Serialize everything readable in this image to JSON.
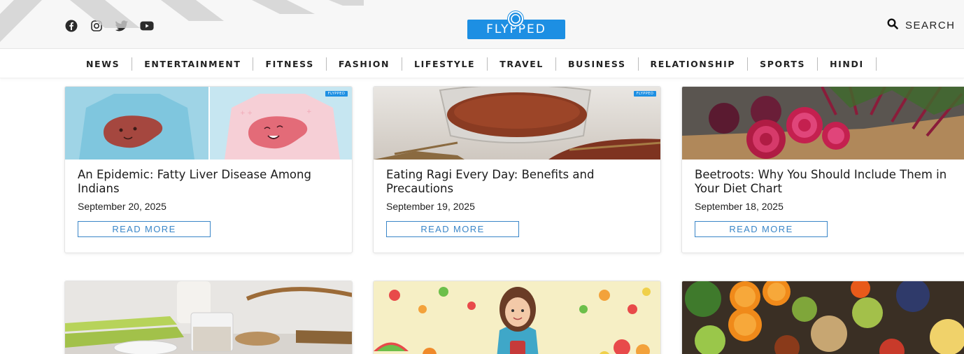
{
  "header": {
    "logo_text": "FLYPPED",
    "search_label": "SEARCH"
  },
  "social_icons": [
    "facebook-icon",
    "instagram-icon",
    "twitter-icon",
    "youtube-icon"
  ],
  "nav": {
    "items": [
      "NEWS",
      "ENTERTAINMENT",
      "FITNESS",
      "FASHION",
      "LIFESTYLE",
      "TRAVEL",
      "BUSINESS",
      "RELATIONSHIP",
      "SPORTS",
      "HINDI"
    ]
  },
  "cards": [
    {
      "title": "An Epidemic: Fatty Liver Disease Among Indians",
      "date": "September 20, 2025",
      "read_more": "READ MORE",
      "image": "fatty-liver-illustration"
    },
    {
      "title": "Eating Ragi Every Day: Benefits and Precautions",
      "date": "September 19, 2025",
      "read_more": "READ MORE",
      "image": "ragi-grains-bowl"
    },
    {
      "title": "Beetroots: Why You Should Include Them in Your Diet Chart",
      "date": "September 18, 2025",
      "read_more": "READ MORE",
      "image": "sliced-beetroots"
    }
  ],
  "colors": {
    "brand_blue": "#1d8fe3",
    "button_blue": "#3a86c8",
    "header_bg": "#f7f7f7"
  }
}
